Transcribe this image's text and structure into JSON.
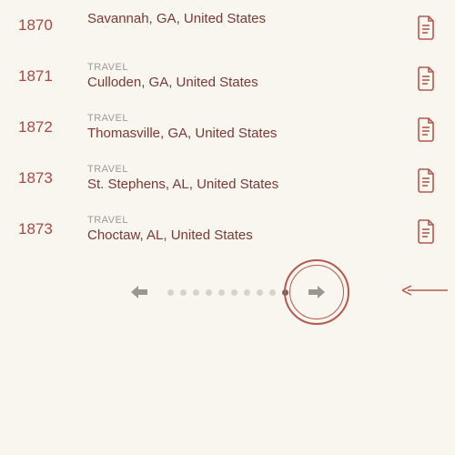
{
  "entries": [
    {
      "year": "1870",
      "category": "",
      "location": "Savannah, GA, United States"
    },
    {
      "year": "1871",
      "category": "TRAVEL",
      "location": "Culloden, GA, United States"
    },
    {
      "year": "1872",
      "category": "TRAVEL",
      "location": "Thomasville, GA, United States"
    },
    {
      "year": "1873",
      "category": "TRAVEL",
      "location": "St. Stephens, AL, United States"
    },
    {
      "year": "1873",
      "category": "TRAVEL",
      "location": "Choctaw, AL, United States"
    }
  ],
  "pagination": {
    "total_dots": 10,
    "active_index": 9
  }
}
